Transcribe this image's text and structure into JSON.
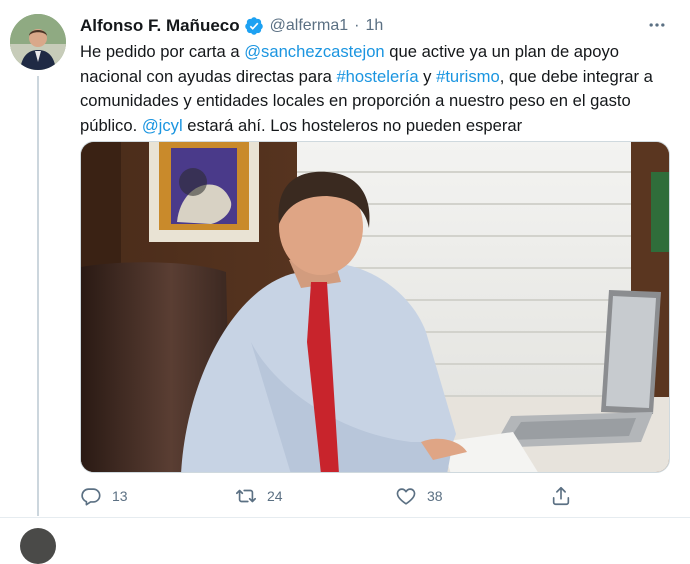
{
  "tweet": {
    "author_name": "Alfonso F. Mañueco",
    "handle": "@alferma1",
    "separator": "·",
    "time": "1h",
    "text_parts": [
      "He pedido por carta a ",
      "@sanchezcastejon",
      " que active ya un plan de apoyo nacional con ayudas directas para ",
      "#hostelería",
      " y ",
      "#turismo",
      ", que debe integrar a comunidades y entidades locales en proporción a nuestro peso en el gasto público. ",
      "@jcyl",
      " estará ahí. Los hosteleros no pueden esperar"
    ],
    "icons": {
      "verified": "verified-badge-icon",
      "more": "more-options-icon",
      "reply": "reply-icon",
      "retweet": "retweet-icon",
      "like": "like-icon",
      "share": "share-icon"
    },
    "actions": {
      "reply_count": "13",
      "retweet_count": "24",
      "like_count": "38"
    },
    "colors": {
      "link": "#1b95e0",
      "verified": "#1da1f2",
      "muted": "#5b7083"
    }
  }
}
